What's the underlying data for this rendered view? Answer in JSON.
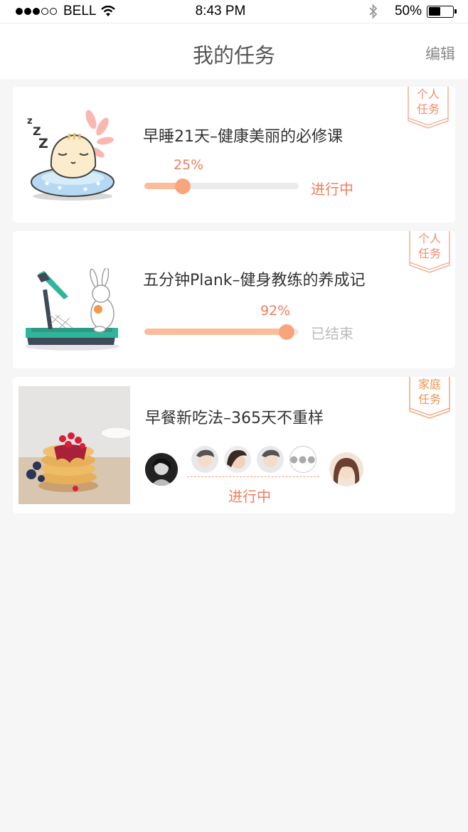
{
  "status_bar": {
    "carrier": "BELL",
    "time": "8:43 PM",
    "battery": "50%"
  },
  "nav": {
    "title": "我的任务",
    "edit_label": "编辑"
  },
  "tasks": [
    {
      "title": "早睡21天–健康美丽的必修课",
      "ribbon": [
        "个人",
        "任务"
      ],
      "progress_label": "25%",
      "progress": 0.25,
      "status": "进行中"
    },
    {
      "title": "五分钟Plank–健身教练的养成记",
      "ribbon": [
        "个人",
        "任务"
      ],
      "progress_label": "92%",
      "progress": 0.92,
      "status": "已结束"
    },
    {
      "title": "早餐新吃法–365天不重样",
      "ribbon": [
        "家庭",
        "任务"
      ],
      "status": "进行中"
    }
  ],
  "colors": {
    "accent": "#f07e5e",
    "progress_fill": "#fbbc9c",
    "knob": "#f9a57c",
    "ribbon_personal": "#f4a88e",
    "ribbon_family": "#f0a070",
    "ended": "#bbbbbb"
  }
}
